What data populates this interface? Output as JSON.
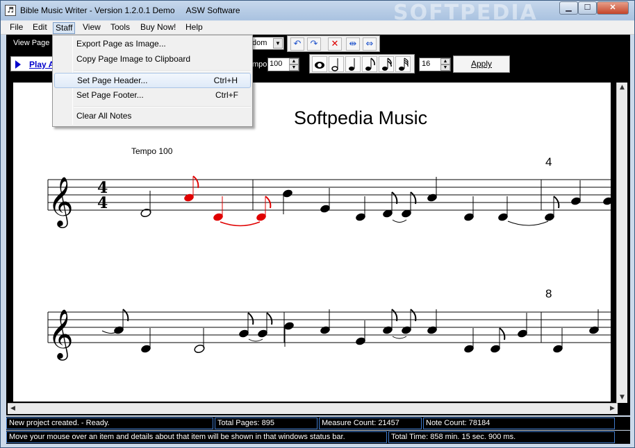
{
  "window": {
    "title": "Bible Music Writer - Version 1.2.0.1 Demo     ASW Software",
    "watermark": "SOFTPEDIA",
    "icon_glyph": "♬",
    "controls": {
      "minimize": "▁",
      "maximize": "☐",
      "close": "✕"
    }
  },
  "menubar": {
    "items": [
      "File",
      "Edit",
      "Staff",
      "View",
      "Tools",
      "Buy Now!",
      "Help"
    ],
    "open_item": "Staff"
  },
  "staff_menu": {
    "export_image": "Export Page as Image...",
    "copy_image": "Copy Page Image to Clipboard",
    "set_header": "Set Page Header...",
    "set_header_shortcut": "Ctrl+H",
    "set_footer": "Set Page Footer...",
    "set_footer_shortcut": "Ctrl+F",
    "clear_notes": "Clear All Notes"
  },
  "toolbar1": {
    "view_page_label": "View Page",
    "random_value": "dom",
    "icons": [
      "undo-icon",
      "redo-icon",
      "delete-icon",
      "fit-width-icon",
      "center-icon"
    ],
    "glyphs": [
      "↶",
      "↷",
      "✕",
      "⇹",
      "⇔"
    ]
  },
  "toolbar2": {
    "play_label": "Play A",
    "tempo_label": "mpo:",
    "tempo_value": "100",
    "note_buttons": [
      "whole-note-icon",
      "half-note-icon",
      "quarter-note-icon",
      "eighth-note-icon",
      "sixteenth-note-icon",
      "thirty-second-note-icon"
    ],
    "note_size_value": "16",
    "apply_label": "Apply"
  },
  "score": {
    "title": "Softpedia Music",
    "tempo_text": "Tempo 100",
    "time_signature_top": "4",
    "time_signature_bottom": "4",
    "measure_numbers": [
      "4",
      "8"
    ],
    "highlight_color": "#e00000"
  },
  "status": {
    "message": "New project created. - Ready.",
    "total_pages": "Total Pages: 895",
    "measure_count": "Measure Count: 21457",
    "note_count": "Note Count: 78184",
    "hint": "Move your mouse over an item and details about that item will be shown in that windows status bar.",
    "total_time": "Total Time: 858 min. 15 sec. 900 ms."
  }
}
